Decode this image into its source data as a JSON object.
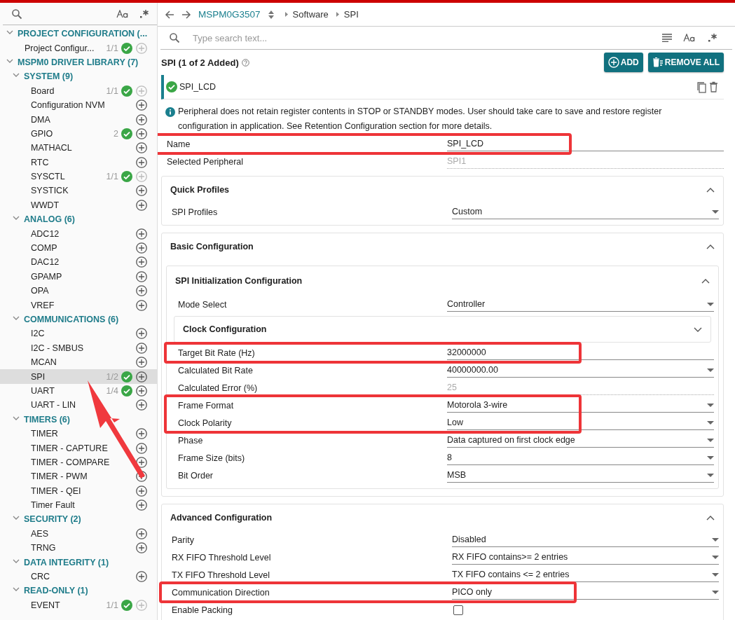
{
  "sidebar": {
    "tree": [
      {
        "label": "PROJECT CONFIGURATION (...",
        "expanded": true,
        "children": [
          {
            "label": "Project Configur...",
            "count": "1/1",
            "added": true,
            "add_disabled": true,
            "selected": false
          }
        ]
      },
      {
        "label": "MSPM0 DRIVER LIBRARY (7)",
        "expanded": true,
        "children": [
          {
            "label": "SYSTEM (9)",
            "expanded": true,
            "children": [
              {
                "label": "Board",
                "count": "1/1",
                "added": true,
                "add_disabled": true,
                "selected": false
              },
              {
                "label": "Configuration NVM",
                "added": false,
                "add_disabled": false,
                "selected": false
              },
              {
                "label": "DMA",
                "added": false,
                "add_disabled": false,
                "selected": false
              },
              {
                "label": "GPIO",
                "count": "2",
                "added": true,
                "add_disabled": false,
                "selected": false
              },
              {
                "label": "MATHACL",
                "added": false,
                "add_disabled": false,
                "selected": false
              },
              {
                "label": "RTC",
                "added": false,
                "add_disabled": false,
                "selected": false
              },
              {
                "label": "SYSCTL",
                "count": "1/1",
                "added": true,
                "add_disabled": true,
                "selected": false
              },
              {
                "label": "SYSTICK",
                "added": false,
                "add_disabled": false,
                "selected": false
              },
              {
                "label": "WWDT",
                "added": false,
                "add_disabled": false,
                "selected": false
              }
            ]
          },
          {
            "label": "ANALOG (6)",
            "expanded": true,
            "children": [
              {
                "label": "ADC12",
                "added": false,
                "add_disabled": false,
                "selected": false
              },
              {
                "label": "COMP",
                "added": false,
                "add_disabled": false,
                "selected": false
              },
              {
                "label": "DAC12",
                "added": false,
                "add_disabled": false,
                "selected": false
              },
              {
                "label": "GPAMP",
                "added": false,
                "add_disabled": false,
                "selected": false
              },
              {
                "label": "OPA",
                "added": false,
                "add_disabled": false,
                "selected": false
              },
              {
                "label": "VREF",
                "added": false,
                "add_disabled": false,
                "selected": false
              }
            ]
          },
          {
            "label": "COMMUNICATIONS (6)",
            "expanded": true,
            "children": [
              {
                "label": "I2C",
                "added": false,
                "add_disabled": false,
                "selected": false
              },
              {
                "label": "I2C - SMBUS",
                "added": false,
                "add_disabled": false,
                "selected": false
              },
              {
                "label": "MCAN",
                "added": false,
                "add_disabled": false,
                "selected": false
              },
              {
                "label": "SPI",
                "count": "1/2",
                "added": true,
                "add_disabled": false,
                "selected": true,
                "pointed": true
              },
              {
                "label": "UART",
                "count": "1/4",
                "added": true,
                "add_disabled": false,
                "selected": false
              },
              {
                "label": "UART - LIN",
                "added": false,
                "add_disabled": false,
                "selected": false
              }
            ]
          },
          {
            "label": "TIMERS (6)",
            "expanded": true,
            "children": [
              {
                "label": "TIMER",
                "added": false,
                "add_disabled": false,
                "selected": false
              },
              {
                "label": "TIMER - CAPTURE",
                "added": false,
                "add_disabled": false,
                "selected": false
              },
              {
                "label": "TIMER - COMPARE",
                "added": false,
                "add_disabled": false,
                "selected": false
              },
              {
                "label": "TIMER - PWM",
                "added": false,
                "add_disabled": false,
                "selected": false
              },
              {
                "label": "TIMER - QEI",
                "added": false,
                "add_disabled": false,
                "selected": false
              },
              {
                "label": "Timer Fault",
                "added": false,
                "add_disabled": false,
                "selected": false
              }
            ]
          },
          {
            "label": "SECURITY (2)",
            "expanded": true,
            "children": [
              {
                "label": "AES",
                "added": false,
                "add_disabled": false,
                "selected": false
              },
              {
                "label": "TRNG",
                "added": false,
                "add_disabled": false,
                "selected": false
              }
            ]
          },
          {
            "label": "DATA INTEGRITY (1)",
            "expanded": true,
            "children": [
              {
                "label": "CRC",
                "added": false,
                "add_disabled": false,
                "selected": false
              }
            ]
          },
          {
            "label": "READ-ONLY (1)",
            "expanded": true,
            "children": [
              {
                "label": "EVENT",
                "count": "1/1",
                "added": true,
                "add_disabled": true,
                "selected": false
              }
            ]
          }
        ]
      }
    ]
  },
  "breadcrumb": {
    "device": "MSPM0G3507",
    "path": [
      "Software",
      "SPI"
    ]
  },
  "search": {
    "placeholder": "Type search text..."
  },
  "module": {
    "title": "SPI (1 of 2 Added)",
    "buttons": [
      {
        "kind": "add",
        "label": "ADD"
      },
      {
        "kind": "remove",
        "label": "REMOVE ALL"
      }
    ],
    "instances": [
      {
        "name": "SPI_LCD",
        "selected": true,
        "added": true
      }
    ],
    "notice": "Peripheral does not retain register contents in STOP or STANDBY modes. User should take care to save and restore register configuration in application. See Retention Configuration section for more details."
  },
  "items": [
    {
      "kind": "text",
      "label": "Name",
      "value": "SPI_LCD",
      "highlight": true
    },
    {
      "kind": "readonly",
      "label": "Selected Peripheral",
      "value": "SPI1"
    },
    {
      "kind": "section",
      "title": "Quick Profiles",
      "expanded": true,
      "items": [
        {
          "kind": "select",
          "label": "SPI Profiles",
          "value": "Custom"
        }
      ]
    },
    {
      "kind": "section",
      "title": "Basic Configuration",
      "expanded": true,
      "items": [
        {
          "kind": "section",
          "title": "SPI Initialization Configuration",
          "expanded": true,
          "items": [
            {
              "kind": "select",
              "label": "Mode Select",
              "value": "Controller"
            },
            {
              "kind": "section",
              "title": "Clock Configuration",
              "expanded": false
            },
            {
              "kind": "text",
              "label": "Target Bit Rate (Hz)",
              "value": "32000000",
              "highlight": true
            },
            {
              "kind": "select",
              "label": "Calculated Bit Rate",
              "value": "40000000.00"
            },
            {
              "kind": "readonly",
              "label": "Calculated Error (%)",
              "value": "25"
            },
            {
              "kind": "select",
              "label": "Frame Format",
              "value": "Motorola 3-wire",
              "highlight": true
            },
            {
              "kind": "select",
              "label": "Clock Polarity",
              "value": "Low",
              "highlight": true
            },
            {
              "kind": "select",
              "label": "Phase",
              "value": "Data captured on first clock edge"
            },
            {
              "kind": "select",
              "label": "Frame Size (bits)",
              "value": "8"
            },
            {
              "kind": "select",
              "label": "Bit Order",
              "value": "MSB"
            }
          ]
        }
      ]
    },
    {
      "kind": "section",
      "title": "Advanced Configuration",
      "expanded": true,
      "items": [
        {
          "kind": "select",
          "label": "Parity",
          "value": "Disabled"
        },
        {
          "kind": "select",
          "label": "RX FIFO Threshold Level",
          "value": "RX FIFO contains>= 2 entries"
        },
        {
          "kind": "select",
          "label": "TX FIFO Threshold Level",
          "value": "TX FIFO contains <= 2 entries"
        },
        {
          "kind": "select",
          "label": "Communication Direction",
          "value": "PICO only",
          "highlight": true
        },
        {
          "kind": "checkbox",
          "label": "Enable Packing",
          "checked": false
        }
      ]
    }
  ]
}
